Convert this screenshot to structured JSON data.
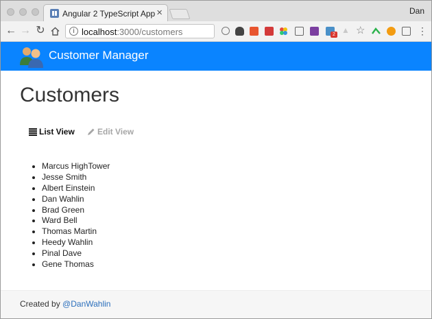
{
  "browser": {
    "tab_title": "Angular 2 TypeScript App",
    "profile_name": "Dan",
    "url_host": "localhost",
    "url_path": ":3000/customers"
  },
  "app": {
    "brand_title": "Customer Manager",
    "accent_color": "#0a84ff",
    "link_color": "#2a6ebb"
  },
  "page": {
    "title": "Customers",
    "tabs": [
      {
        "label": "List View",
        "icon": "list-icon",
        "state": "active"
      },
      {
        "label": "Edit View",
        "icon": "pencil-icon",
        "state": "disabled"
      }
    ],
    "customers": [
      "Marcus HighTower",
      "Jesse Smith",
      "Albert Einstein",
      "Dan Wahlin",
      "Brad Green",
      "Ward Bell",
      "Thomas Martin",
      "Heedy Wahlin",
      "Pinal Dave",
      "Gene Thomas"
    ]
  },
  "footer": {
    "prefix": "Created by",
    "link_text": "@DanWahlin"
  }
}
